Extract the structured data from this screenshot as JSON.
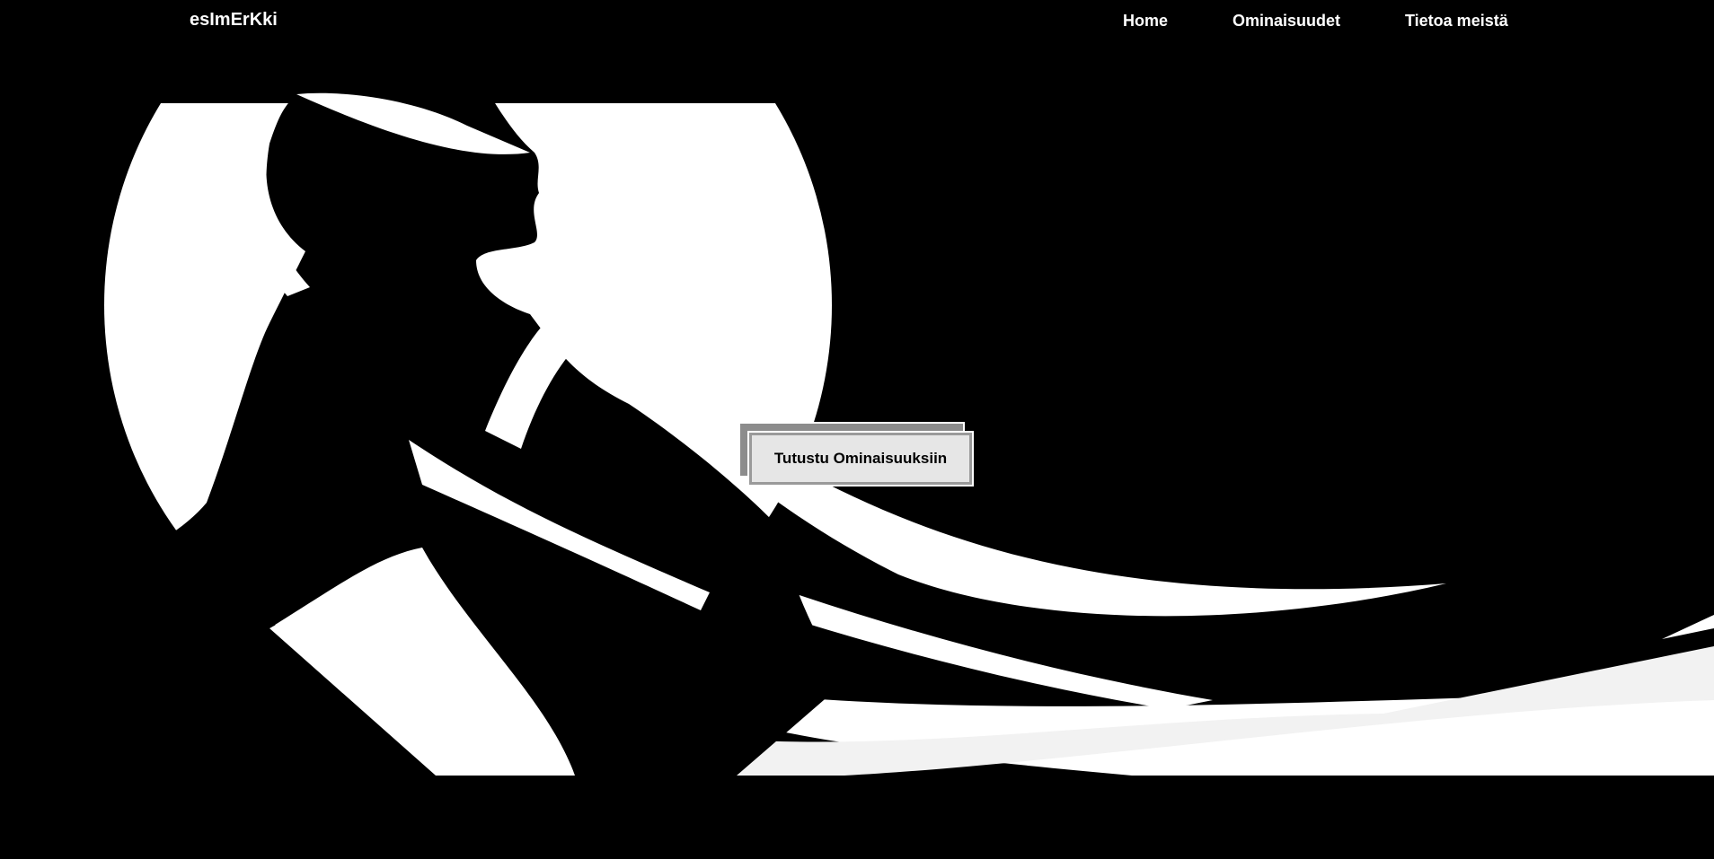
{
  "header": {
    "brand": "esImErKki",
    "nav": [
      {
        "label": "Home"
      },
      {
        "label": "Ominaisuudet"
      },
      {
        "label": "Tietoa meistä"
      }
    ]
  },
  "hero": {
    "image": "woman-silhouette-illustration",
    "cta_label": "Tutustu Ominaisuuksiin"
  },
  "colors": {
    "background": "#000000",
    "text": "#ffffff",
    "button_face": "#e6e6e6",
    "button_shadow": "#8c8c8c"
  }
}
